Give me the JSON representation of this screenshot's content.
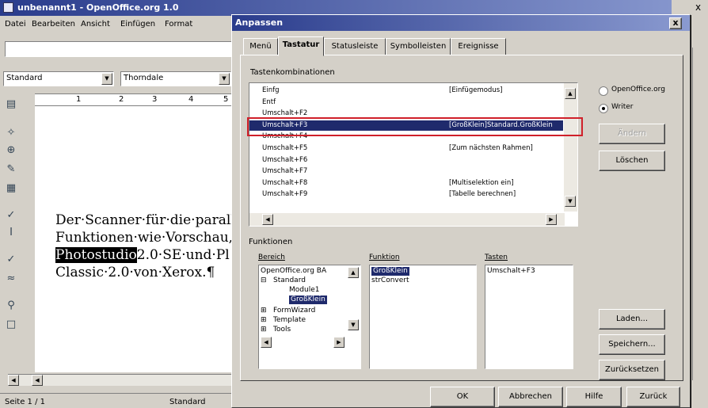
{
  "app": {
    "title": "unbenannt1 - OpenOffice.org 1.0",
    "menus": [
      "Datei",
      "Bearbeiten",
      "Ansicht",
      "Einfügen",
      "Format"
    ],
    "style_value": "Standard",
    "font_value": "Thorndale",
    "ruler_marks": [
      "1",
      "2",
      "3",
      "4",
      "5"
    ],
    "document_lines": [
      "Der·Scanner·für·die·paralle",
      "Funktionen·wie·Vorschau,",
      "2.0·SE·und·Pl",
      "Classic·2.0·von·Xerox.¶"
    ],
    "highlighted_word": "Photostudio",
    "status": {
      "page": "Seite 1 / 1",
      "style": "Standard"
    },
    "close_glyph": "x",
    "left_toolbar_icons": [
      "edit-icon",
      "autopilot-icon",
      "insert-object-icon",
      "draw-icon",
      "table-icon",
      "spellcheck-icon",
      "text-cursor-icon",
      "autocorrect-icon",
      "spelling-underline-icon",
      "find-icon",
      "frame-icon"
    ]
  },
  "dialog": {
    "title": "Anpassen",
    "close_glyph": "x",
    "tabs": [
      "Menü",
      "Tastatur",
      "Statusleiste",
      "Symbolleisten",
      "Ereignisse"
    ],
    "active_tab": "Tastatur",
    "shortcuts_label": "Tastenkombinationen",
    "shortcuts": [
      {
        "key": "Einfg",
        "cmd": "[Einfügemodus]"
      },
      {
        "key": "Entf",
        "cmd": ""
      },
      {
        "key": "Umschalt+F2",
        "cmd": ""
      },
      {
        "key": "Umschalt+F3",
        "cmd": "[GroßKlein]Standard.GroßKlein"
      },
      {
        "key": "Umschalt+F4",
        "cmd": ""
      },
      {
        "key": "Umschalt+F5",
        "cmd": "[Zum nächsten Rahmen]"
      },
      {
        "key": "Umschalt+F6",
        "cmd": ""
      },
      {
        "key": "Umschalt+F7",
        "cmd": ""
      },
      {
        "key": "Umschalt+F8",
        "cmd": "[Multiselektion ein]"
      },
      {
        "key": "Umschalt+F9",
        "cmd": "[Tabelle berechnen]"
      }
    ],
    "selected_shortcut_index": 3,
    "radio_openoffice": "OpenOffice.org",
    "radio_writer": "Writer",
    "radio_selected": "writer",
    "btn_modify": "Ändern",
    "btn_delete": "Löschen",
    "functions_label": "Funktionen",
    "col_area": "Bereich",
    "col_function": "Funktion",
    "col_keys": "Tasten",
    "area_tree": [
      "OpenOffice.org BA",
      "Standard",
      "Module1",
      "GroßKlein",
      "FormWizard",
      "Template",
      "Tools"
    ],
    "function_items": [
      "GroßKlein",
      "strConvert"
    ],
    "keys_items": [
      "Umschalt+F3"
    ],
    "btn_load": "Laden...",
    "btn_save": "Speichern...",
    "btn_reset": "Zurücksetzen",
    "btn_ok": "OK",
    "btn_cancel": "Abbrechen",
    "btn_help": "Hilfe",
    "btn_back": "Zurück"
  },
  "colors": {
    "selection": "#1f2a6c",
    "highlight_box": "#d0202a",
    "title_start": "#2a3c8c"
  }
}
